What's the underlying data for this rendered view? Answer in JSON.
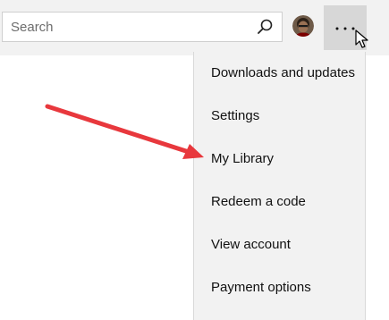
{
  "search": {
    "placeholder": "Search",
    "value": ""
  },
  "icons": {
    "search": "search-icon",
    "account": "avatar",
    "more": "more-horizontal-icon",
    "cursor": "mouse-pointer-icon",
    "annotation": "red-arrow"
  },
  "menu": {
    "items": [
      {
        "label": "Downloads and updates"
      },
      {
        "label": "Settings"
      },
      {
        "label": "My Library"
      },
      {
        "label": "Redeem a code"
      },
      {
        "label": "View account"
      },
      {
        "label": "Payment options"
      }
    ]
  },
  "colors": {
    "annotation_arrow": "#e8383d",
    "more_button_bg": "#d7d7d7",
    "toolbar_bg": "#f2f2f2",
    "menu_bg": "#f2f2f2"
  }
}
